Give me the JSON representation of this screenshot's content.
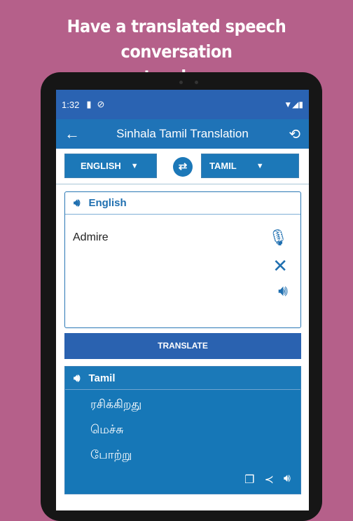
{
  "headline": {
    "line1": "Have a translated speech conversation",
    "line2": "across two languages"
  },
  "status": {
    "time": "1:32",
    "icons": [
      "sd-card-icon",
      "data-saver-icon",
      "wifi-icon",
      "signal-icon",
      "battery-icon"
    ]
  },
  "appbar": {
    "title": "Sinhala Tamil Translation",
    "back_icon": "arrow-left-icon",
    "history_icon": "history-icon"
  },
  "languages": {
    "source": "ENGLISH",
    "target": "TAMIL",
    "swap_icon": "swap-icon"
  },
  "input_card": {
    "label": "English",
    "text": "Admire",
    "icons": [
      "microphone-icon",
      "close-icon",
      "speaker-icon"
    ]
  },
  "translate_label": "TRANSLATE",
  "output_card": {
    "label": "Tamil",
    "lines": [
      "ரசிக்கிறது",
      "மெச்சு",
      "போற்று"
    ],
    "icons": [
      "copy-icon",
      "share-icon",
      "speaker-icon"
    ]
  },
  "colors": {
    "background": "#b5608a",
    "status_bar": "#2a63b2",
    "app_bar": "#1f73b7",
    "button": "#1c78b8",
    "translate": "#2a62b0"
  }
}
